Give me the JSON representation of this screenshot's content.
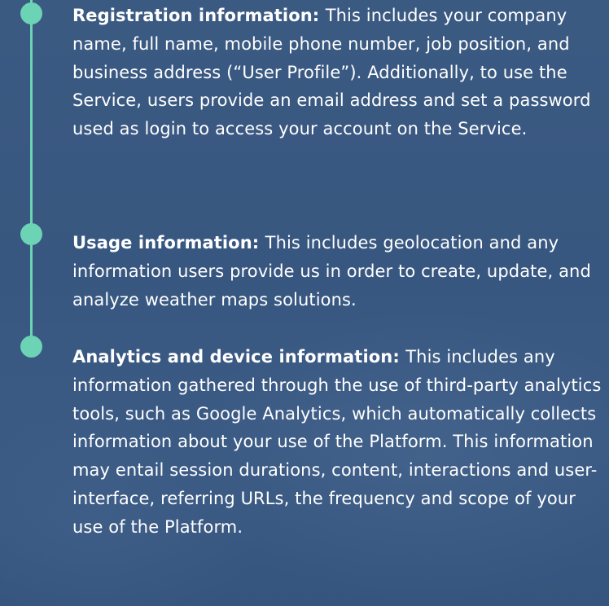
{
  "items": [
    {
      "title": "Registration information:",
      "text": "This includes your company name, full name, mobile phone number, job position, and business address (“User Profile”). Additionally, to use the Service, users provide an email address and set a password used as login to access your account on the Service."
    },
    {
      "title": "Usage information:",
      "text": "This includes geolocation and any information users provide us in order to create, update, and analyze weather maps solutions."
    },
    {
      "title": "Analytics and device information:",
      "text": "This includes any information gathered through the use of third-party analytics tools, such as Google Analytics, which automatically collects information about your use of the Platform. This information may entail session durations, content, interactions and user-interface, referring URLs, the frequency and scope of your use of the Platform."
    }
  ],
  "colors": {
    "background": "#3a5982",
    "accent": "#6cd3b5",
    "text": "#ffffff"
  }
}
